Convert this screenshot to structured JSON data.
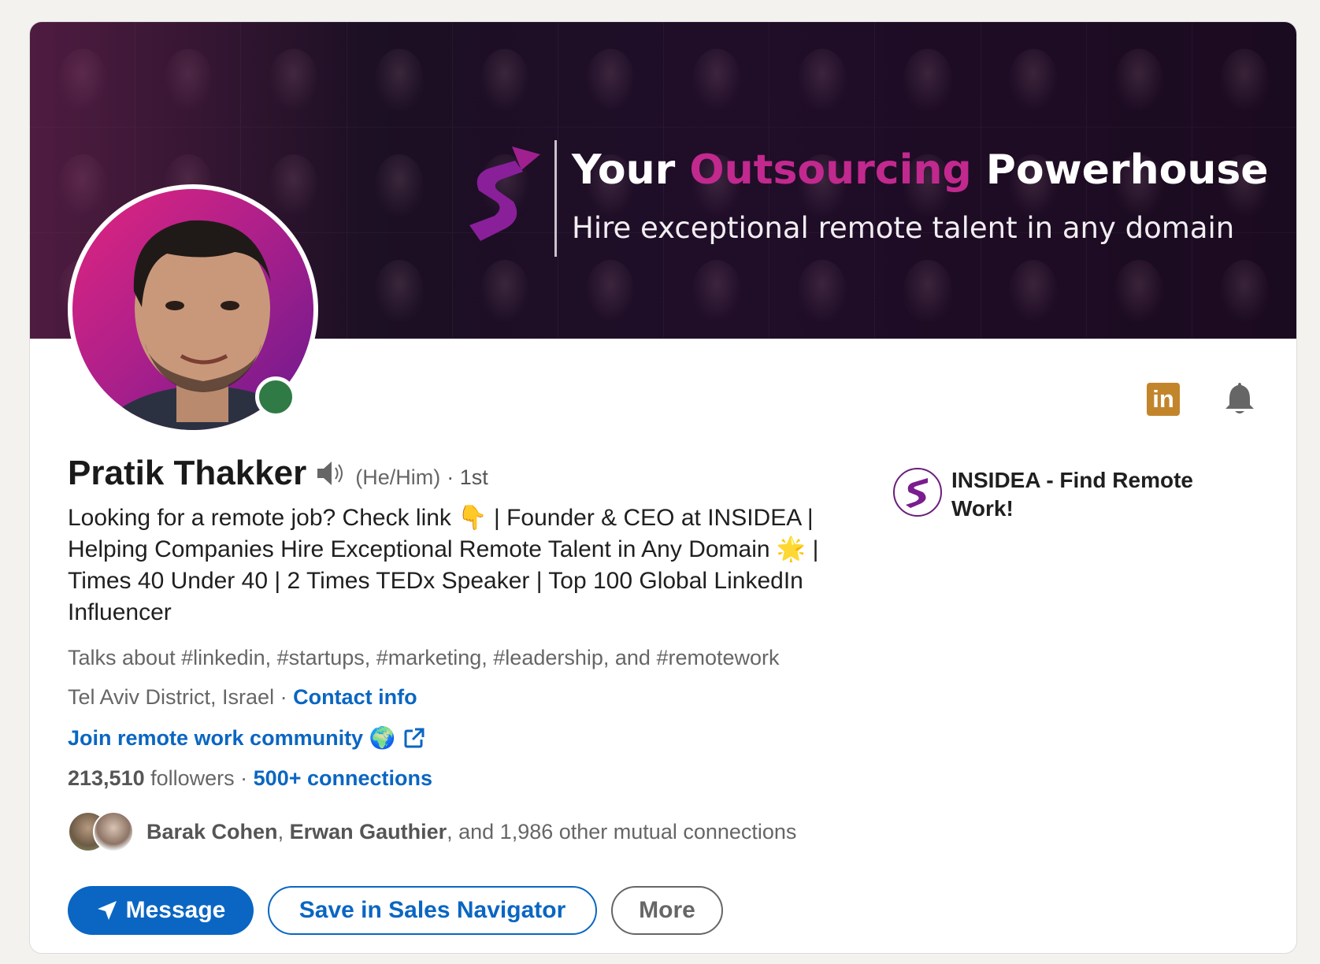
{
  "banner": {
    "headline_part1": "Your ",
    "headline_accent": "Outsourcing",
    "headline_part2": " Powerhouse",
    "subline": "Hire exceptional remote talent in any domain",
    "accent_color": "#c1298e"
  },
  "profile": {
    "name": "Pratik Thakker",
    "pronouns": "(He/Him)",
    "degree": "· 1st",
    "headline": "Looking for a remote job? Check link 👇 | Founder & CEO at INSIDEA | Helping Companies Hire Exceptional Remote Talent in Any Domain 🌟 | Times 40 Under 40 | 2 Times TEDx Speaker | Top 100 Global LinkedIn Influencer",
    "talks_about": "Talks about #linkedin, #startups, #marketing, #leadership, and #remotework",
    "location": "Tel Aviv District, Israel",
    "location_sep": " · ",
    "contact_info": "Contact info",
    "community_link": "Join remote work community 🌍",
    "followers_count": "213,510",
    "followers_label": " followers",
    "connections_sep": "  · ",
    "connections": "500+ connections",
    "presence": "online",
    "presence_color": "#2f7a45"
  },
  "mutual": {
    "name1": "Barak Cohen",
    "sep": ", ",
    "name2": "Erwan Gauthier",
    "rest": ", and 1,986 other mutual connections"
  },
  "company": {
    "name": "INSIDEA - Find Remote Work!"
  },
  "actions": {
    "message": "Message",
    "save": "Save in Sales Navigator",
    "more": "More"
  },
  "icons": {
    "linkedin": "in",
    "brand_color": "#0a66c2"
  }
}
